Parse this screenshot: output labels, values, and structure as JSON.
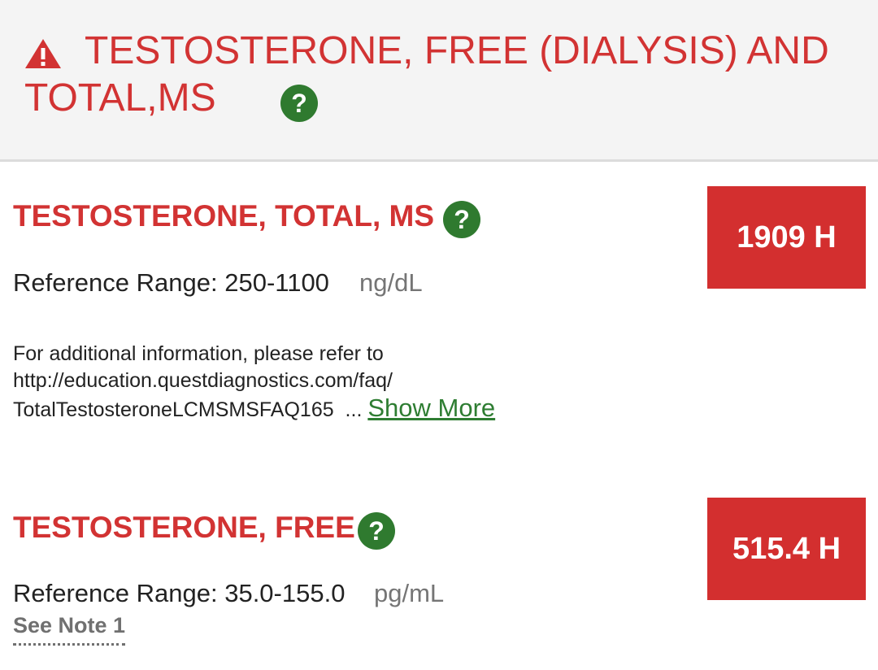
{
  "panel": {
    "title": "TESTOSTERONE, FREE (DIALYSIS) AND TOTAL,MS",
    "warning_icon": "warning-triangle-icon",
    "help_icon": "question-circle-icon",
    "help_glyph": "?"
  },
  "results": [
    {
      "name": "TESTOSTERONE, TOTAL, MS",
      "value": "1909 H",
      "reference_label": "Reference Range: 250-1100",
      "unit": "ng/dL",
      "info_lines": [
        "For additional information, please refer to",
        "http://education.questdiagnostics.com/faq/",
        "TotalTestosteroneLCMSMSFAQ165"
      ],
      "ellipsis": "...",
      "show_more": "Show More"
    },
    {
      "name": "TESTOSTERONE, FREE",
      "value": "515.4 H",
      "reference_label": "Reference Range: 35.0-155.0",
      "unit": "pg/mL",
      "note_link": "See Note 1"
    }
  ],
  "colors": {
    "title_red": "#d23333",
    "flag_box_red": "#d32f2f",
    "help_green": "#2f7a2f",
    "link_green": "#2e7d32",
    "header_bg": "#f4f4f4"
  }
}
